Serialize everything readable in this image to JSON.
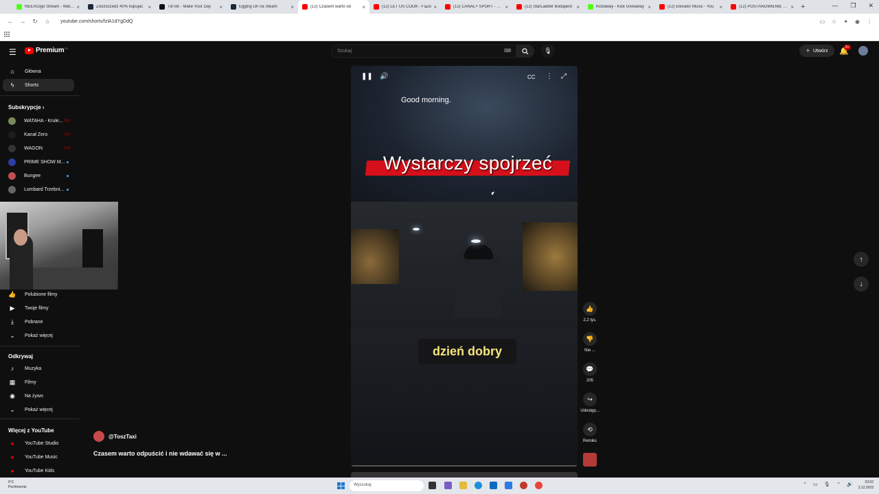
{
  "browser": {
    "tabs": [
      {
        "title": "NEEXcogo Stream - Watch",
        "color": "#53fc18",
        "active": false
      },
      {
        "title": "Zoozoczedz 40% kupujac",
        "color": "#1e2a3a",
        "active": false
      },
      {
        "title": "TikTok - Make Your Day",
        "color": "#111111",
        "active": false
      },
      {
        "title": "Egging On na Steam",
        "color": "#1b2838",
        "active": false
      },
      {
        "title": "(12) Czasem warto od",
        "color": "#ff0000",
        "active": true
      },
      {
        "title": "(12) LET US COOK - FaZe",
        "color": "#ff0000",
        "active": false
      },
      {
        "title": "(12) CANAL+ SPORT - You",
        "color": "#ff0000",
        "active": false
      },
      {
        "title": "(12) StarLadder Budapest",
        "color": "#ff0000",
        "active": false
      },
      {
        "title": "Kickaway - Kick Giveaway",
        "color": "#53fc18",
        "active": false
      },
      {
        "title": "(12) Elevator Music - You",
        "color": "#ff0000",
        "active": false
      },
      {
        "title": "(12) POSTANOWIENIE NO",
        "color": "#ff0000",
        "active": false
      }
    ],
    "url": "youtube.com/shorts/fzlA1dYgDdQ"
  },
  "yt": {
    "logo_text": "Premium",
    "logo_sup": "PL",
    "search_placeholder": "Szukaj",
    "create_label": "Utwórz",
    "notif_count": "9+"
  },
  "sidebar": {
    "main": [
      {
        "label": "Główna",
        "icon": "⌂",
        "active": false
      },
      {
        "label": "Shorts",
        "icon": "ϟ",
        "active": true
      }
    ],
    "subs_heading": "Subskrypcje",
    "subs": [
      {
        "label": "WATAHA - Krule...",
        "color": "#7a8a5a",
        "badge": "live"
      },
      {
        "label": "Kanał Zero",
        "color": "#1d1d1d",
        "badge": "live"
      },
      {
        "label": "WAGON",
        "color": "#333333",
        "badge": "live"
      },
      {
        "label": "PRIME SHOW M...",
        "color": "#2d3ea8",
        "badge": "dot"
      },
      {
        "label": "Bungee",
        "color": "#c05050",
        "badge": "dot"
      },
      {
        "label": "Lombard Trzebni...",
        "color": "#666666",
        "badge": "dot"
      }
    ],
    "you": [
      {
        "label": "Polubione filmy",
        "icon": "👍"
      },
      {
        "label": "Twoje filmy",
        "icon": "▶"
      },
      {
        "label": "Pobrane",
        "icon": "⤓"
      },
      {
        "label": "Pokaż więcej",
        "icon": "⌄"
      }
    ],
    "explore_heading": "Odkrywaj",
    "explore": [
      {
        "label": "Muzyka",
        "icon": "♪"
      },
      {
        "label": "Filmy",
        "icon": "▦"
      },
      {
        "label": "Na żywo",
        "icon": "◉"
      },
      {
        "label": "Pokaż więcej",
        "icon": "⌄"
      }
    ],
    "more_heading": "Więcej z YouTube",
    "more": [
      {
        "label": "YouTube Studio"
      },
      {
        "label": "YouTube Music"
      },
      {
        "label": "YouTube Kids"
      }
    ]
  },
  "video": {
    "caption_top": "Good morning.",
    "caption_big": "Wystarczy spojrzeć",
    "caption_bottom": "dzień dobry"
  },
  "actions": [
    {
      "name": "like",
      "icon": "👍",
      "label": "2,2 tys."
    },
    {
      "name": "dislike",
      "icon": "👎",
      "label": "Nie ..."
    },
    {
      "name": "comments",
      "icon": "💬",
      "label": "205"
    },
    {
      "name": "share",
      "icon": "↪",
      "label": "Udostęp..."
    },
    {
      "name": "remix",
      "icon": "⟲",
      "label": "Remiks"
    }
  ],
  "short_meta": {
    "channel": "@ToszTaxi",
    "title": "Czasem warto odpuścić i nie wdawać się w ..."
  },
  "taskbar": {
    "weather_temp": "5°C",
    "weather_desc": "Pochmurnie",
    "search_placeholder": "Wyszukaj",
    "time": "23:02",
    "date": "3.12.2023"
  }
}
